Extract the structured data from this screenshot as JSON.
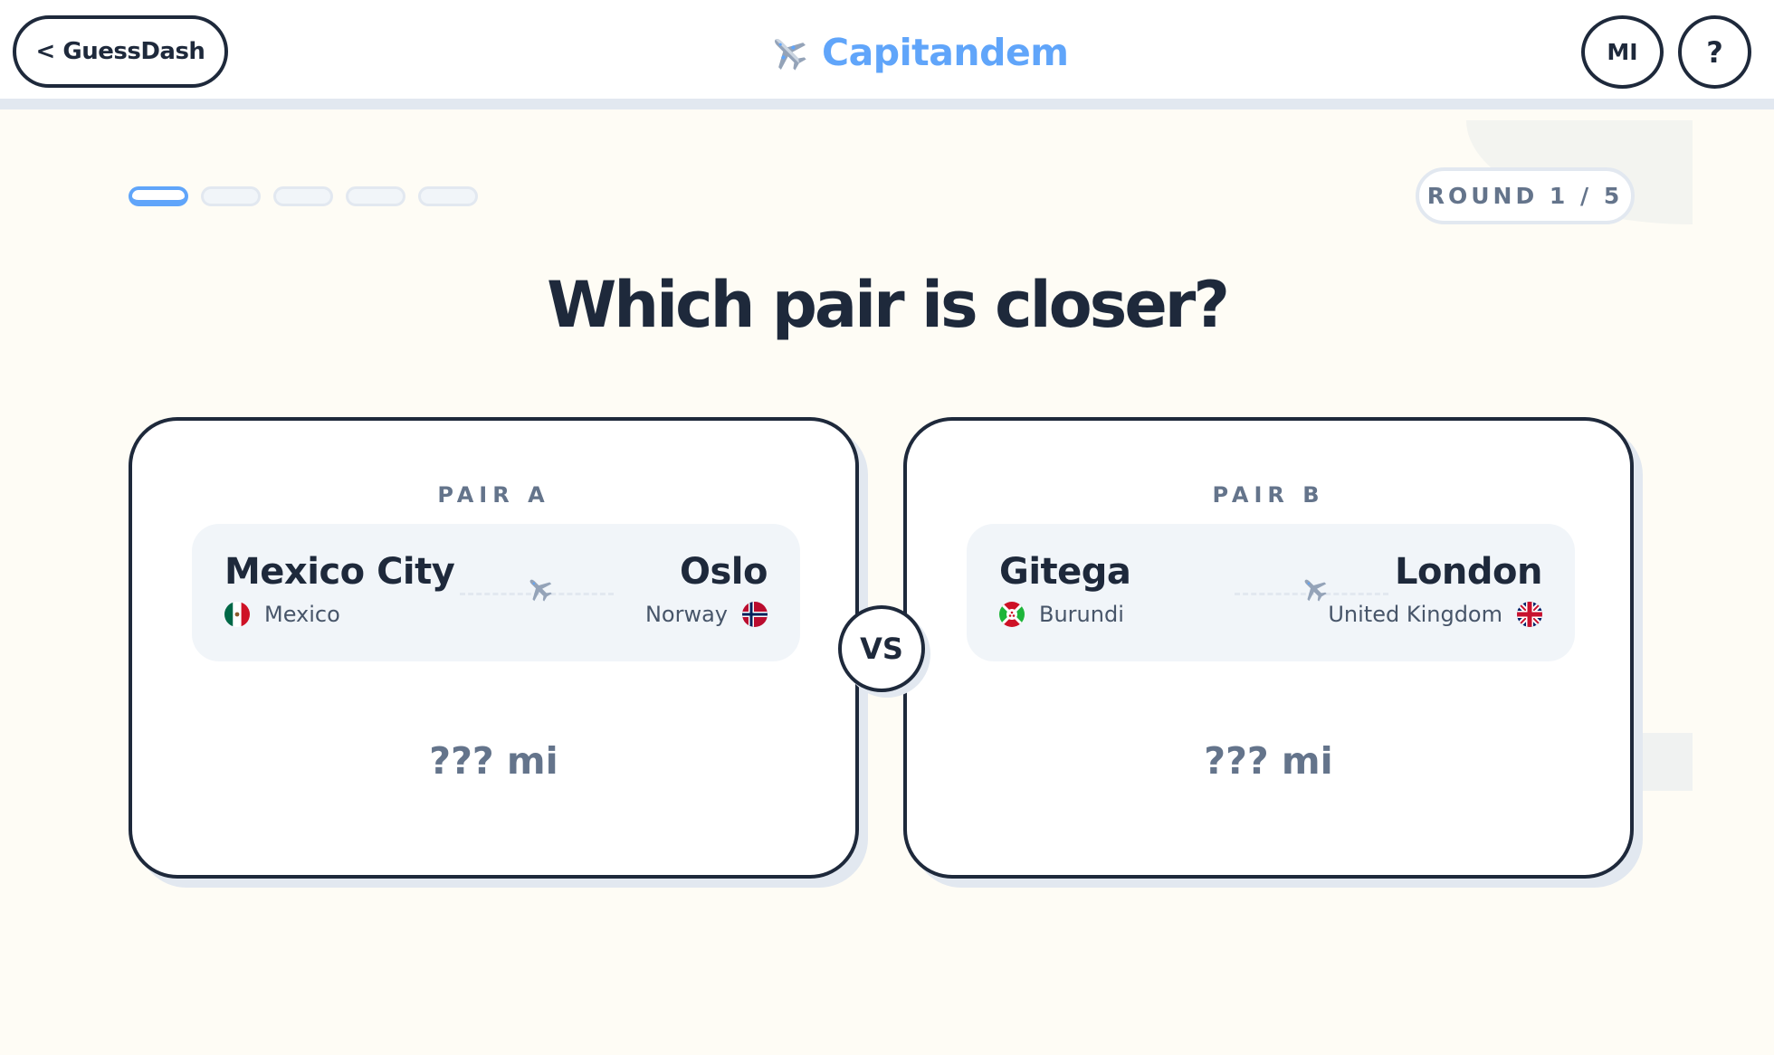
{
  "header": {
    "back_label": "< GuessDash",
    "brand_icon": "airplane-icon",
    "brand_name": "Capitandem",
    "brand_color": "#60a5fa",
    "units_label": "MI",
    "help_label": "?"
  },
  "progress": {
    "current": 1,
    "total": 5,
    "round_label": "ROUND 1 / 5"
  },
  "question": "Which pair is closer?",
  "pairs": [
    {
      "label": "PAIR A",
      "from": {
        "city": "Mexico City",
        "country": "Mexico",
        "flag": "mexico-flag-icon"
      },
      "to": {
        "city": "Oslo",
        "country": "Norway",
        "flag": "norway-flag-icon"
      },
      "distance": "??? mi"
    },
    {
      "label": "PAIR B",
      "from": {
        "city": "Gitega",
        "country": "Burundi",
        "flag": "burundi-flag-icon"
      },
      "to": {
        "city": "London",
        "country": "United Kingdom",
        "flag": "uk-flag-icon"
      },
      "distance": "??? mi"
    }
  ],
  "vs_label": "VS",
  "colors": {
    "ink": "#1e293b",
    "accent": "#60a5fa",
    "muted": "#64748b",
    "background": "#fefcf5"
  }
}
